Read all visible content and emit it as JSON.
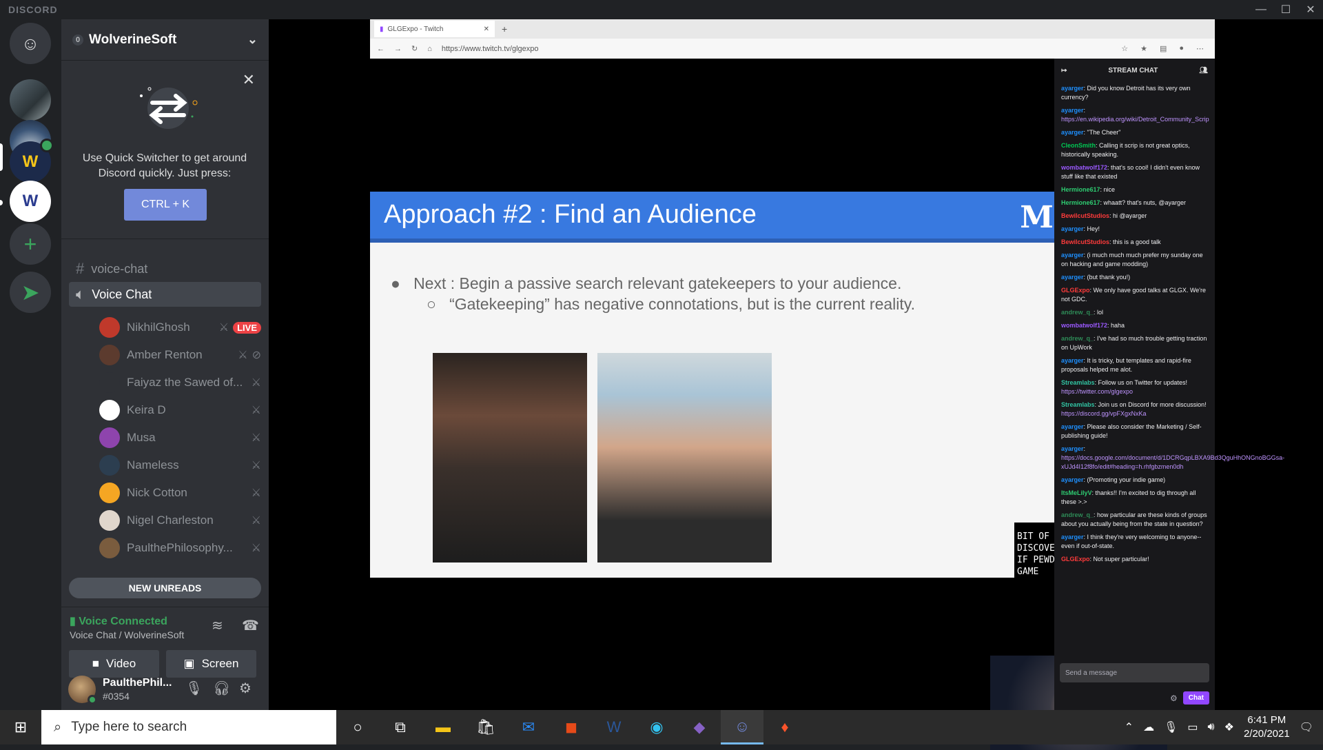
{
  "app": {
    "brand": "DISCORD"
  },
  "server": {
    "name": "WolverineSoft",
    "badge": "0"
  },
  "quick_switcher": {
    "text": "Use Quick Switcher to get around Discord quickly. Just press:",
    "shortcut": "CTRL + K"
  },
  "channels": [
    {
      "type": "text",
      "name": "voice-chat"
    },
    {
      "type": "voice",
      "name": "Voice Chat"
    }
  ],
  "voice_users": [
    {
      "name": "NikhilGhosh",
      "live": "LIVE",
      "avatar_color": "#c0392b"
    },
    {
      "name": "Amber Renton",
      "avatar_color": "#5c3b2e"
    },
    {
      "name": "Faiyaz the Sawed of...",
      "avatar_color": "#2f3136"
    },
    {
      "name": "Keira D",
      "avatar_color": "#ffffff"
    },
    {
      "name": "Musa",
      "avatar_color": "#8e44ad"
    },
    {
      "name": "Nameless",
      "avatar_color": "#2c3e50"
    },
    {
      "name": "Nick Cotton",
      "avatar_color": "#f5a623"
    },
    {
      "name": "Nigel Charleston",
      "avatar_color": "#e0d6cc"
    },
    {
      "name": "PaulthePhilosophy...",
      "avatar_color": "#7a5c3e"
    }
  ],
  "new_unreads": "NEW UNREADS",
  "voice_status": {
    "title": "Voice Connected",
    "subtitle": "Voice Chat / WolverineSoft"
  },
  "buttons": {
    "video": "Video",
    "screen": "Screen"
  },
  "user": {
    "name": "PaulthePhil...",
    "tag": "#0354"
  },
  "browser": {
    "tab_title": "GLGExpo - Twitch",
    "url": "https://www.twitch.tv/glgexpo"
  },
  "slide": {
    "title": "Approach #2 : Find an Audience",
    "logo": "M",
    "bullet1": "Next : Begin a passive search relevant gatekeepers to your audience.",
    "bullet2": "“Gatekeeping” has negative connotations, but is the current reality."
  },
  "caption": "BIT OF SALES AND DISCOVERABILITY THAT WAY IF PEWDIEPIE PLAYS YOUR GAME",
  "stream_chat": {
    "header": "STREAM CHAT",
    "messages": [
      {
        "user": "ayarger",
        "color": "#1e90ff",
        "text": "Did you know Detroit has its very own currency?"
      },
      {
        "user": "ayarger",
        "color": "#1e90ff",
        "link": "https://en.wikipedia.org/wiki/Detroit_Community_Scrip"
      },
      {
        "user": "ayarger",
        "color": "#1e90ff",
        "text": "\"The Cheer\""
      },
      {
        "user": "CleonSmith",
        "color": "#00c853",
        "text": "Calling it scrip is not great optics, historically speaking."
      },
      {
        "user": "wombatwolf172",
        "color": "#9b59ff",
        "text": "that's so cool! I didn't even know stuff like that existed"
      },
      {
        "user": "Hermione617",
        "color": "#2ecc71",
        "text": "nice"
      },
      {
        "user": "Hermione617",
        "color": "#2ecc71",
        "text": "whaatt? that's nuts, @ayarger"
      },
      {
        "user": "BewilcutStudios",
        "color": "#ff3b3b",
        "text": "hi @ayarger"
      },
      {
        "user": "ayarger",
        "color": "#1e90ff",
        "text": "Hey!"
      },
      {
        "user": "BewilcutStudios",
        "color": "#ff3b3b",
        "text": "this is a good talk"
      },
      {
        "user": "ayarger",
        "color": "#1e90ff",
        "text": "(i much much much prefer my sunday one on hacking and game modding)"
      },
      {
        "user": "ayarger",
        "color": "#1e90ff",
        "text": "(but thank you!)"
      },
      {
        "user": "GLGExpo",
        "color": "#ff3b3b",
        "text": "We only have good talks at GLGX. We're not GDC."
      },
      {
        "user": "andrew_q_",
        "color": "#2e8b57",
        "text": "lol"
      },
      {
        "user": "wombatwolf172",
        "color": "#9b59ff",
        "text": "haha"
      },
      {
        "user": "andrew_q_",
        "color": "#2e8b57",
        "text": "I've had so much trouble getting traction on UpWork"
      },
      {
        "user": "ayarger",
        "color": "#1e90ff",
        "text": "It is tricky, but templates and rapid-fire proposals helped me alot."
      },
      {
        "user": "Streamlabs",
        "color": "#31c3a2",
        "text": "Follow us on Twitter for updates!",
        "link": "https://twitter.com/glgexpo"
      },
      {
        "user": "Streamlabs",
        "color": "#31c3a2",
        "text": "Join us on Discord for more discussion!",
        "link": "https://discord.gg/vpFXgxNxKa"
      },
      {
        "user": "ayarger",
        "color": "#1e90ff",
        "text": "Please also consider the Marketing / Self-publishing guide!"
      },
      {
        "user": "ayarger",
        "color": "#1e90ff",
        "link": "https://docs.google.com/document/d/1DCRGqpLBXA9Bd3QguHhONGnoBGGsa-xUJd4I12f8fo/edit#heading=h.rhfgbzmen0dh"
      },
      {
        "user": "ayarger",
        "color": "#1e90ff",
        "text": "(Promoting your indie game)"
      },
      {
        "user": "ItsMeLilyV",
        "color": "#2ecc71",
        "text": "thanks!! I'm excited to dig through all these >.>"
      },
      {
        "user": "andrew_q_",
        "color": "#2e8b57",
        "text": "how particular are these kinds of groups about you actually being from the state in question?"
      },
      {
        "user": "ayarger",
        "color": "#1e90ff",
        "text": "I think they're very welcoming to anyone-- even if out-of-state."
      },
      {
        "user": "GLGExpo",
        "color": "#ff3b3b",
        "text": "Not super particular!"
      }
    ],
    "input_placeholder": "Send a message",
    "send_label": "Chat"
  },
  "taskbar": {
    "search_placeholder": "Type here to search",
    "time": "6:41 PM",
    "date": "2/20/2021"
  }
}
